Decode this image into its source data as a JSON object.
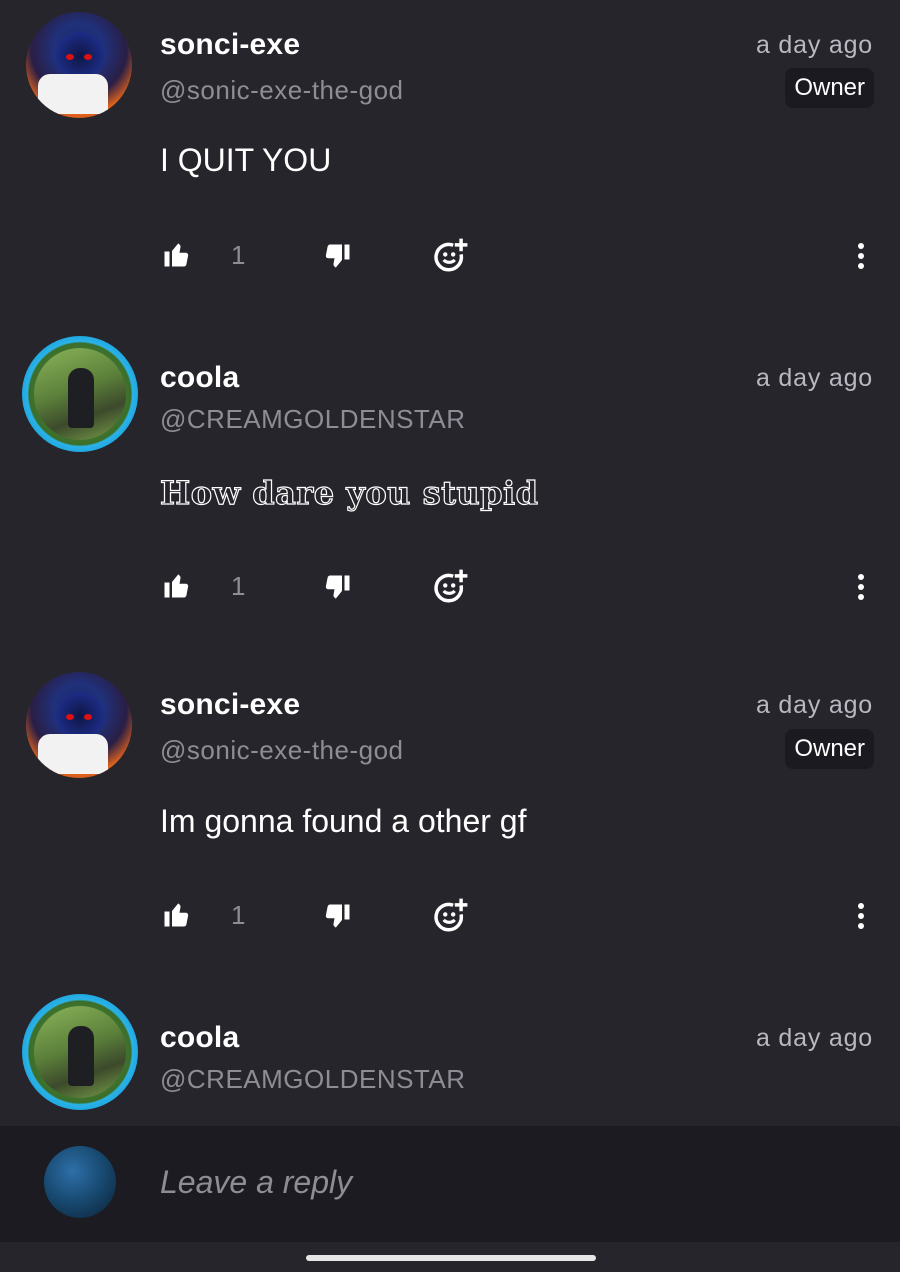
{
  "comments": [
    {
      "username": "sonci-exe",
      "handle": "@sonic-exe-the-god",
      "time": "a day ago",
      "badge": "Owner",
      "text": "I QUIT YOU",
      "likes": "1"
    },
    {
      "username": "coola",
      "handle": "@CREAMGOLDENSTAR",
      "time": "a day ago",
      "badge": "",
      "text": "How dare you stupid",
      "likes": "1"
    },
    {
      "username": "sonci-exe",
      "handle": "@sonic-exe-the-god",
      "time": "a day ago",
      "badge": "Owner",
      "text": "Im gonna found a other gf",
      "likes": "1"
    },
    {
      "username": "coola",
      "handle": "@CREAMGOLDENSTAR",
      "time": "a day ago",
      "badge": "",
      "text": "",
      "likes": ""
    }
  ],
  "reply": {
    "placeholder": "Leave a reply"
  },
  "icons": {
    "like": "thumbs-up-icon",
    "dislike": "thumbs-down-icon",
    "react": "add-reaction-icon",
    "more": "more-vertical-icon"
  },
  "colors": {
    "background": "#26252c",
    "muted": "#8e8d95",
    "badge_bg": "#1b1a20",
    "reply_bar": "#1c1b21"
  }
}
